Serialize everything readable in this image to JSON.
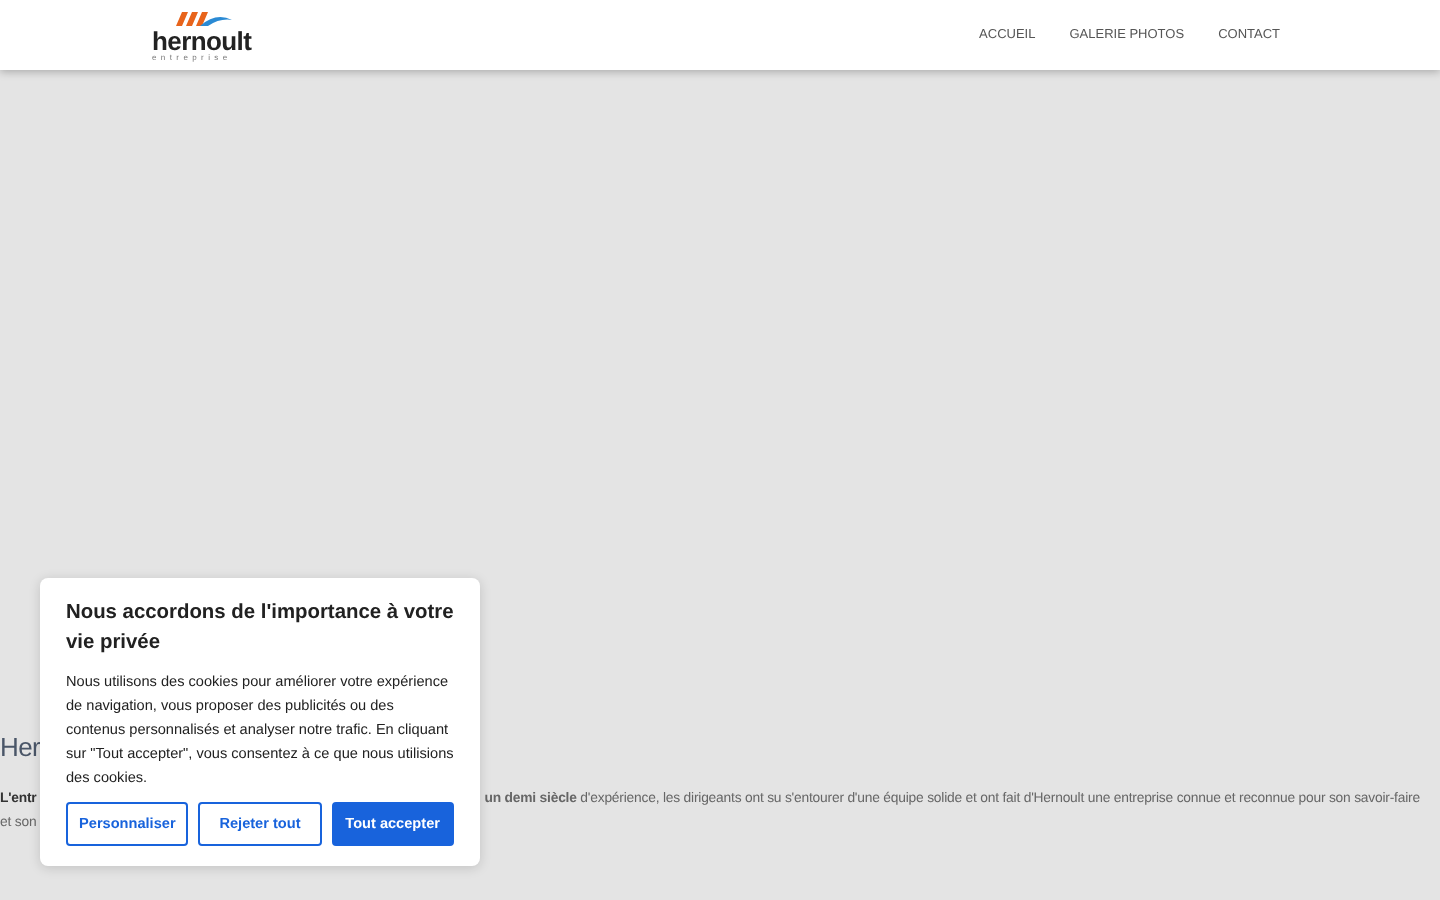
{
  "header": {
    "logo": {
      "name": "hernoult",
      "tagline": "entreprise"
    },
    "nav": [
      {
        "label": "ACCUEIL"
      },
      {
        "label": "GALERIE PHOTOS"
      },
      {
        "label": "CONTACT"
      }
    ]
  },
  "page": {
    "heading": "Her",
    "paragraph_start": "L'entr",
    "paragraph_rest": "**un demi siècle** d'expérience, les dirigeants ont su s'entourer d'une équipe solide et ont fait d'Hernoult une entreprise connue et reconnue pour son savoir-faire",
    "paragraph_line2": "et son"
  },
  "cookie_banner": {
    "title": "Nous accordons de l'importance à votre vie privée",
    "text": "Nous utilisons des cookies pour améliorer votre expérience de navigation, vous proposer des publicités ou des contenus personnalisés et analyser notre trafic. En cliquant sur \"Tout accepter\", vous consentez à ce que nous utilisions des cookies.",
    "buttons": [
      {
        "label": "Personnaliser",
        "kind": "outline"
      },
      {
        "label": "Rejeter tout",
        "kind": "outline"
      },
      {
        "label": "Tout accepter",
        "kind": "primary"
      }
    ]
  }
}
